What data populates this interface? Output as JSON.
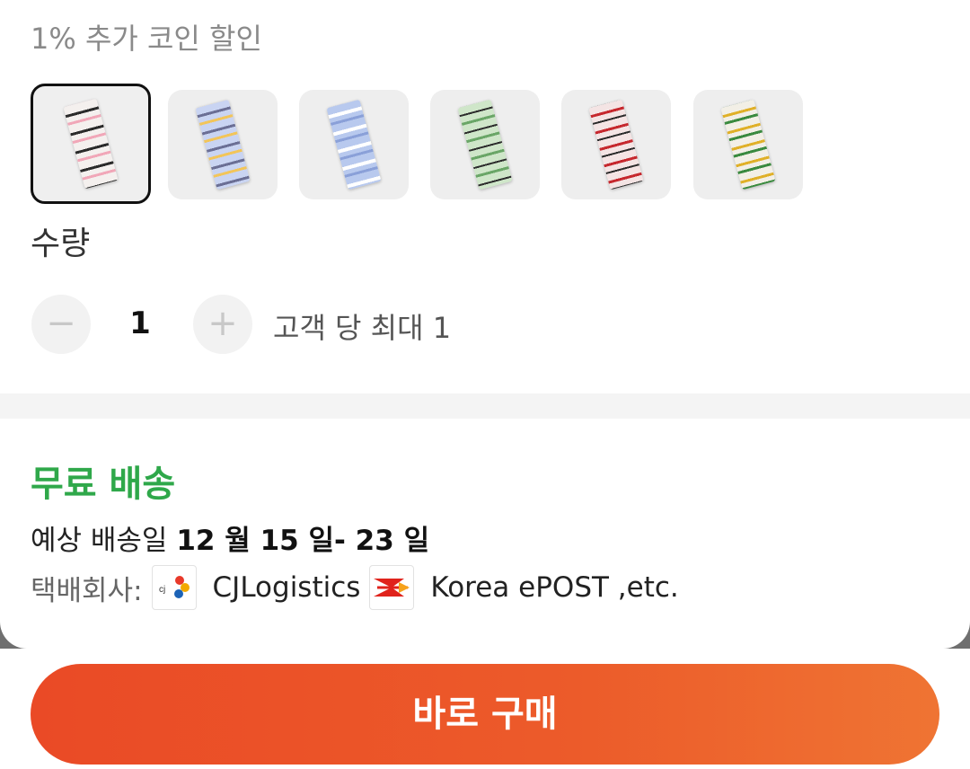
{
  "discount_text": "1% 추가 코인 할인",
  "variants": [
    {
      "name": "variant-1",
      "colors": [
        "#f4f0ee",
        "#2b2b2b",
        "#f1a7b8"
      ],
      "selected": true
    },
    {
      "name": "variant-2",
      "colors": [
        "#c9d4f2",
        "#6b6f95",
        "#f2c55a"
      ],
      "selected": false
    },
    {
      "name": "variant-3",
      "colors": [
        "#b8c9ee",
        "#ffffff",
        "#8aa0d8"
      ],
      "selected": false
    },
    {
      "name": "variant-4",
      "colors": [
        "#cfe6c9",
        "#2d2d2d",
        "#6aa667"
      ],
      "selected": false
    },
    {
      "name": "variant-5",
      "colors": [
        "#f4e4e4",
        "#c6282e",
        "#2b2b2b"
      ],
      "selected": false
    },
    {
      "name": "variant-6",
      "colors": [
        "#f2efe6",
        "#e0b028",
        "#3a8a3f"
      ],
      "selected": false
    }
  ],
  "quantity": {
    "label": "수량",
    "minus_symbol": "−",
    "value": "1",
    "plus_symbol": "+",
    "limit_text": "고객 당 최대 1"
  },
  "shipping": {
    "title": "무료 배송",
    "eta_prefix": "예상 배송일",
    "eta_dates": "12 월 15 일- 23 일",
    "carriers_label": "택배회사:",
    "carrier_1": "CJLogistics",
    "carrier_2": "Korea ePOST ,etc."
  },
  "buy_button": "바로 구매",
  "colors": {
    "accent_green": "#2fa84a",
    "buy_button_start": "#ea4a26",
    "buy_button_end": "#ef7433"
  }
}
